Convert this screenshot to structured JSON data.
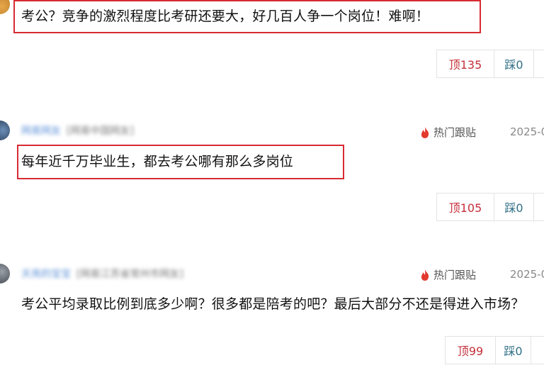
{
  "comments": [
    {
      "text": "考公？竞争的激烈程度比考研还要大，好几百人争一个岗位！难啊！",
      "up_label": "顶135",
      "down_label": "踩0"
    },
    {
      "author": "网易网友",
      "source": "[网易中国网友]",
      "hot_label": "热门跟贴",
      "date": "2025-0",
      "text": "每年近千万毕业生，都去考公哪有那么多岗位",
      "up_label": "顶105",
      "down_label": "踩0"
    },
    {
      "author": "天亮的宝宝",
      "source": "[网易江苏省常州市网友]",
      "hot_label": "热门跟贴",
      "date": "2025-0",
      "text": "考公平均录取比例到底多少啊？很多都是陪考的吧？最后大部分不还是得进入市场？",
      "up_label": "顶99",
      "down_label": "踩0"
    }
  ],
  "colors": {
    "highlight_box": "#d62b33",
    "up_text": "#c4303a",
    "down_text": "#2f6f85",
    "fire_icon": "#e33a2f"
  }
}
